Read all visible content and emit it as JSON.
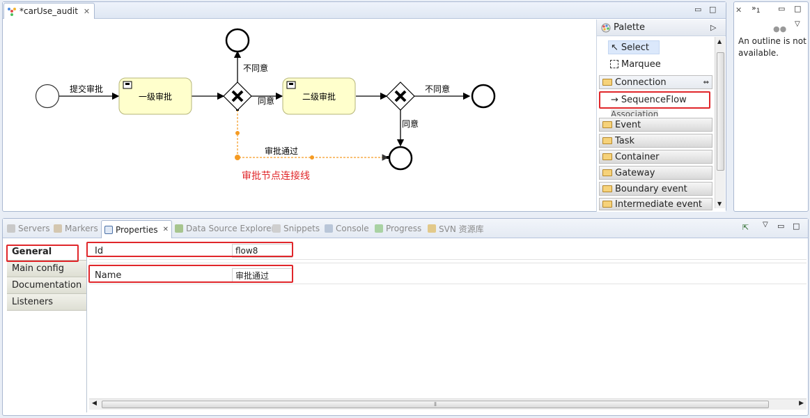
{
  "editor": {
    "tab_title": "*carUse_audit",
    "diagram": {
      "start_flow_label": "提交审批",
      "task1": "一级审批",
      "task2": "二级审批",
      "reject1": "不同意",
      "agree1": "同意",
      "reject2": "不同意",
      "agree2": "同意",
      "approved_flow": "审批通过",
      "annotation": "审批节点连接线"
    }
  },
  "palette": {
    "title": "Palette",
    "tools": [
      "Select",
      "Marquee"
    ],
    "drawers": [
      {
        "label": "Connection",
        "items": [
          "SequenceFlow",
          "Association"
        ]
      },
      {
        "label": "Event"
      },
      {
        "label": "Task"
      },
      {
        "label": "Container"
      },
      {
        "label": "Gateway"
      },
      {
        "label": "Boundary event"
      },
      {
        "label": "Intermediate event"
      }
    ]
  },
  "outline": {
    "text_line1": "An outline is not",
    "text_line2": "available.",
    "badge": "1"
  },
  "views": {
    "tabs": [
      "Servers",
      "Markers",
      "Properties",
      "Data Source Explorer",
      "Snippets",
      "Console",
      "Progress",
      "SVN 资源库"
    ],
    "active_tab": "Properties"
  },
  "properties": {
    "sections": [
      "General",
      "Main config",
      "Documentation",
      "Listeners"
    ],
    "fields": [
      {
        "label": "Id",
        "value": "flow8"
      },
      {
        "label": "Name",
        "value": "审批通过"
      }
    ]
  },
  "colors": {
    "task_fill": "#ffffcc",
    "task_border": "#b5b57a",
    "selected_flow": "#f59b23",
    "highlight": "#e0262a",
    "annotation": "#e0262a"
  }
}
